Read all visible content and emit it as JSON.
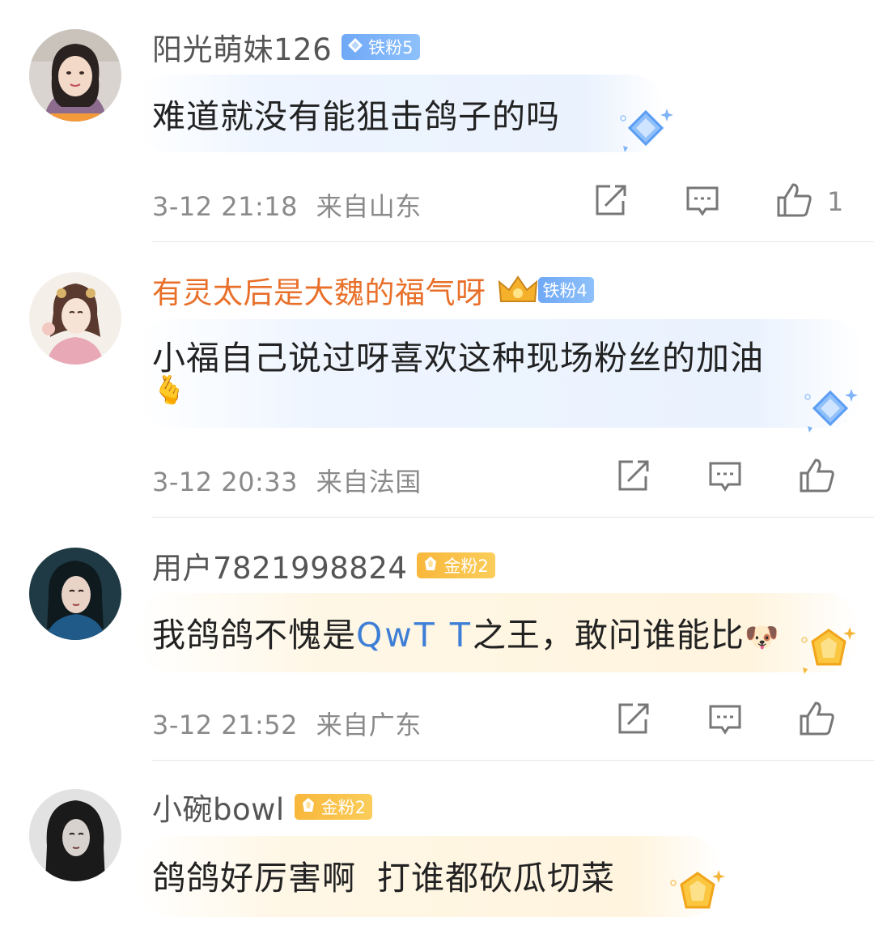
{
  "comments": [
    {
      "username": "阳光萌妹126",
      "badge": "铁粉5",
      "badge_color": "#79b2f8",
      "text": "难道就没有能狙击鸽子的吗",
      "time": "3-12 21:18",
      "location": "来自山东",
      "likes": "1"
    },
    {
      "username": "有灵太后是大魏的福气呀",
      "username_color": "#e8702a",
      "badge": "铁粉4",
      "badge_color": "#79b2f8",
      "text": "小福自己说过呀喜欢这种现场粉丝的加油",
      "emoji": "🫰",
      "time": "3-12 20:33",
      "location": "来自法国"
    },
    {
      "username": "用户7821998824",
      "badge": "金粉2",
      "badge_color": "#f8b73b",
      "text_before": "我鸽鸽不愧是",
      "text_highlight": "QwT T",
      "text_after": "之王，敢问谁能比",
      "emoji": "🐶",
      "time": "3-12 21:52",
      "location": "来自广东"
    },
    {
      "username": "小碗bowl",
      "badge": "金粉2",
      "badge_color": "#f8b73b",
      "text": "鸽鸽好厉害啊 打谁都砍瓜切菜"
    }
  ],
  "icons": {
    "repost": "repost-icon",
    "comment": "comment-icon",
    "like": "thumbs-up-icon",
    "badge_gem": "diamond-icon"
  }
}
